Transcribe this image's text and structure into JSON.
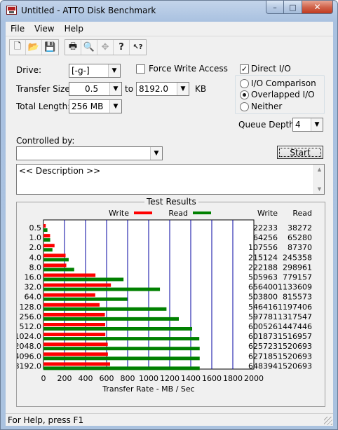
{
  "window": {
    "title": "Untitled - ATTO Disk Benchmark"
  },
  "caption": {
    "minimize": "–",
    "maximize": "□",
    "close": "✕"
  },
  "menu": [
    "File",
    "View",
    "Help"
  ],
  "toolbar": {
    "icons": [
      "new-file-icon",
      "open-folder-icon",
      "save-icon",
      "print-icon",
      "print-preview-icon",
      "move-icon",
      "help-icon",
      "context-help-icon"
    ],
    "glyphs": [
      "🗋",
      "📂",
      "💾",
      "🖶",
      "🔍",
      "✥",
      "?",
      "↖?"
    ]
  },
  "form": {
    "drive_label": "Drive:",
    "drive_value": "[-g-]",
    "transfer_size_label": "Transfer Size:",
    "transfer_from": "0.5",
    "to_label": "to",
    "transfer_to": "8192.0",
    "kb_label": "KB",
    "total_length_label": "Total Length:",
    "total_length_value": "256 MB",
    "force_write_access": {
      "label": "Force Write Access",
      "checked": false
    },
    "direct_io": {
      "label": "Direct I/O",
      "checked": true,
      "mark": "✓"
    },
    "io_modes": [
      {
        "label": "I/O Comparison",
        "selected": false
      },
      {
        "label": "Overlapped I/O",
        "selected": true
      },
      {
        "label": "Neither",
        "selected": false
      }
    ],
    "queue_depth_label": "Queue Depth:",
    "queue_depth_value": "4",
    "controlled_by_label": "Controlled by:",
    "controlled_by_value": "",
    "start_label": "Start",
    "description": "<< Description >>"
  },
  "status": {
    "text": "For Help, press F1"
  },
  "colors": {
    "write": "#ff0000",
    "read": "#008000",
    "grid": "#0000a0"
  },
  "chart_data": {
    "type": "bar",
    "title": "Test Results",
    "legend": [
      "Write",
      "Read"
    ],
    "xlabel": "Transfer Rate - MB / Sec",
    "xlim": [
      0,
      2000
    ],
    "xticks": [
      "0",
      "200",
      "400",
      "600",
      "800",
      "1000",
      "1200",
      "1400",
      "1600",
      "1800",
      "2000"
    ],
    "column_headers": [
      "Write",
      "Read"
    ],
    "categories": [
      "0.5",
      "1.0",
      "2.0",
      "4.0",
      "8.0",
      "16.0",
      "32.0",
      "64.0",
      "128.0",
      "256.0",
      "512.0",
      "1024.0",
      "2048.0",
      "4096.0",
      "8192.0"
    ],
    "series": [
      {
        "name": "Write",
        "values": [
          22233,
          64256,
          107556,
          215124,
          222188,
          505963,
          656400,
          503800,
          546416,
          597781,
          600526,
          601873,
          625723,
          627185,
          648394
        ]
      },
      {
        "name": "Read",
        "values": [
          38272,
          65280,
          87370,
          245358,
          298961,
          779157,
          1133609,
          815573,
          1197406,
          1317547,
          1447446,
          1516957,
          1520693,
          1520693,
          1520693
        ]
      }
    ],
    "units_note": "values in KB/sec as printed; bars scaled to MB/Sec axis"
  }
}
